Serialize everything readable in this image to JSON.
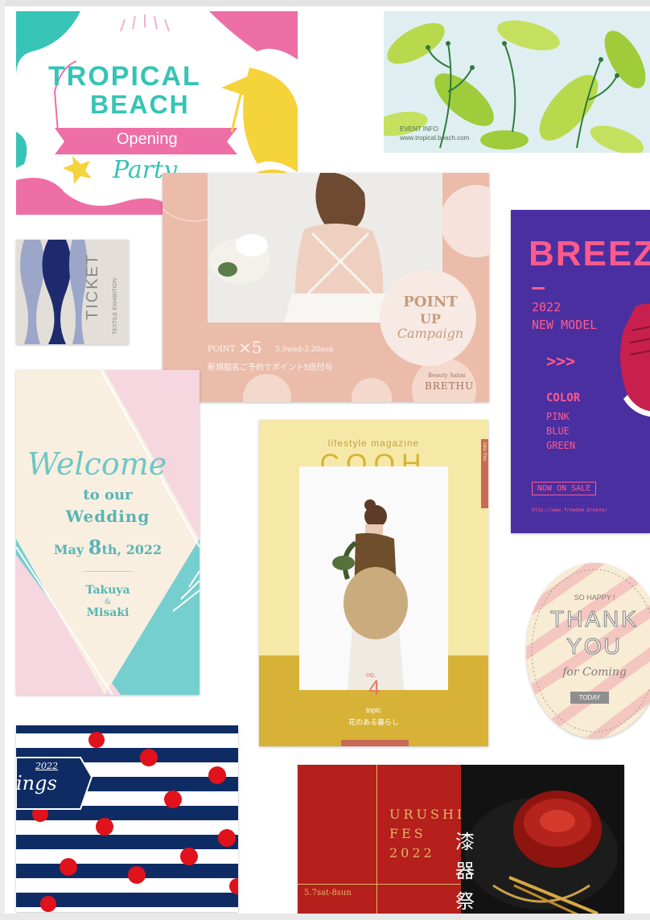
{
  "colors": {
    "tropical_pink": "#ee6ea6",
    "tropical_teal": "#35c4b5",
    "tropical_yellow": "#f5d33a",
    "salon_pink": "#ebbcaa",
    "breeze_purple": "#4a2fa0",
    "breeze_pink": "#ff5a8c",
    "wedding_teal": "#76cfcf",
    "cooh_yellow": "#f6e9a8",
    "cooh_mustard": "#d7b236",
    "stripe_navy": "#0e2c63",
    "stripe_red": "#e0121b",
    "urushi_red": "#b51f1c",
    "urushi_gold": "#e2b866"
  },
  "tropical": {
    "title_line1": "TROPICAL",
    "title_line2": "BEACH",
    "ribbon": "Opening",
    "script": "Party"
  },
  "event_info": {
    "label": "EVENT INFO",
    "url": "www.tropical.beach.com"
  },
  "ticket": {
    "title": "TICKET",
    "subtitle": "TEXTILE EXHIBITION"
  },
  "salon": {
    "point_up": "POINT",
    "point_up2": "UP",
    "campaign": "Campaign",
    "point_prefix": "POINT",
    "multiplier": "×5",
    "dates": "3.9wed-3.20sun",
    "japanese": "新規指名ご予約でポイント5倍付与",
    "brand_line1": "Beauty Salon",
    "brand_line2": "BRETHU"
  },
  "breeze": {
    "title": "BREEZ",
    "year": "2022",
    "model": "NEW MODEL",
    "arrows": ">>>",
    "color_label": "COLOR",
    "colors": [
      "PINK",
      "BLUE",
      "GREEN"
    ],
    "cta": "NOW ON SALE",
    "url": "http://www.freedom.breeze/"
  },
  "wedding": {
    "script": "Welcome",
    "line1": "to our",
    "line2": "Wedding",
    "date_pre": "May",
    "date_num": "8",
    "date_post": "th, 2022",
    "name1": "Takuya",
    "amp": "&",
    "name2": "Misaki"
  },
  "cooh": {
    "kicker": "lifestyle magazine",
    "title": "COOH",
    "side_tab": "take free",
    "no_label": "no.",
    "number": "4",
    "topic_label": "topic",
    "topic": "花のある暮らし"
  },
  "thank_you": {
    "top": "SO HAPPY !",
    "line1": "THANK",
    "line2": "YOU",
    "script": "for Coming",
    "tag": "TODAY"
  },
  "stripes": {
    "year": "2022",
    "script": "ings"
  },
  "urushi": {
    "line1": "URUSHI",
    "line2": "FES",
    "line3": "2022",
    "kanji": [
      "漆",
      "器",
      "祭"
    ],
    "dates": "5.7sat-8sun"
  }
}
